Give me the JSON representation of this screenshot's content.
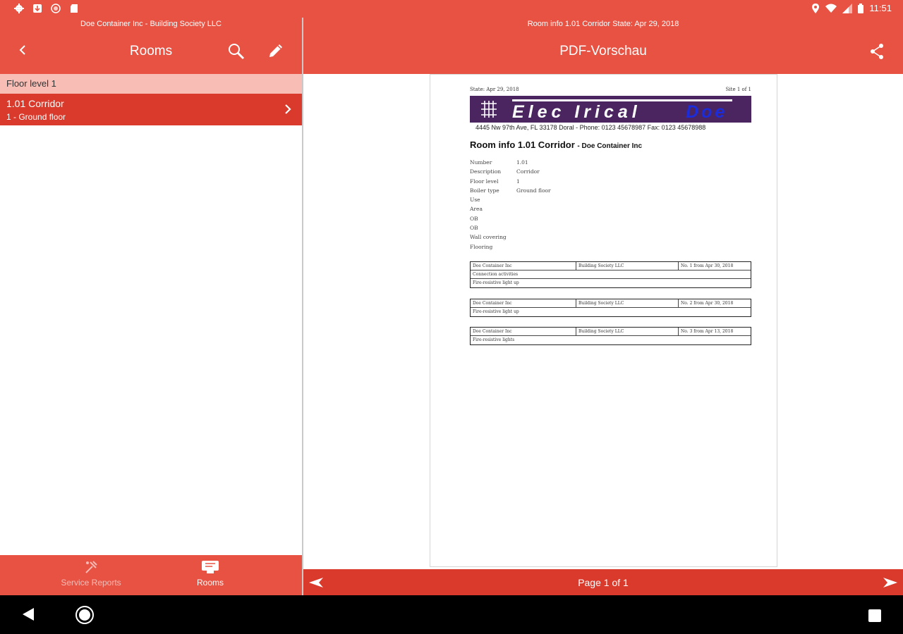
{
  "status_bar": {
    "time": "11:51",
    "left_icons": [
      "settings-icon",
      "download-icon",
      "sync-icon",
      "sd-card-icon"
    ],
    "right_icons": [
      "location-icon",
      "wifi-icon",
      "signal-icon",
      "battery-icon"
    ]
  },
  "left_pane": {
    "subtitle": "Doe Container Inc - Building Society LLC",
    "title": "Rooms",
    "section_header": "Floor level 1",
    "items": [
      {
        "title": "1.01 Corridor",
        "subtitle": "1 - Ground floor"
      }
    ],
    "bottom_nav": [
      {
        "label": "Service Reports",
        "icon": "service-reports-icon",
        "active": false
      },
      {
        "label": "Rooms",
        "icon": "rooms-icon",
        "active": true
      }
    ]
  },
  "right_pane": {
    "subtitle": "Room info 1.01 Corridor State: Apr 29, 2018",
    "title": "PDF-Vorschau",
    "pager": {
      "label": "Page 1 of 1"
    }
  },
  "pdf": {
    "state": "State: Apr 29, 2018",
    "site": "Site 1 of 1",
    "banner_word": "Elec Irical",
    "banner_brand": "Doe",
    "address": "4445 Nw 97th Ave, FL 33178 Doral - Phone: 0123 45678987 Fax: 0123 45678988",
    "heading": "Room info 1.01 Corridor",
    "heading_sub": "- Doe Container Inc",
    "fields": [
      {
        "label": "Number",
        "value": "1.01"
      },
      {
        "label": "Description",
        "value": "Corridor"
      },
      {
        "label": "Floor level",
        "value": "1"
      },
      {
        "label": "Boiler type",
        "value": "Ground floor"
      },
      {
        "label": "Use",
        "value": ""
      },
      {
        "label": "Area",
        "value": ""
      },
      {
        "label": "OB",
        "value": ""
      },
      {
        "label": "OB",
        "value": ""
      },
      {
        "label": "Wall covering",
        "value": ""
      },
      {
        "label": "Flooring",
        "value": ""
      }
    ],
    "tables": [
      {
        "c1": "Doe Container Inc",
        "c2": "Building Society LLC",
        "c3": "No. 1 from Apr 30, 2018",
        "notes": [
          "Connection activities",
          "Fire-resistive light up"
        ]
      },
      {
        "c1": "Doe Container Inc",
        "c2": "Building Society LLC",
        "c3": "No. 2 from Apr 30, 2018",
        "notes": [
          "Fire-resistive light up"
        ]
      },
      {
        "c1": "Doe Container Inc",
        "c2": "Building Society LLC",
        "c3": "No. 3 from Apr 13, 2018",
        "notes": [
          "Fire-resistive lights"
        ]
      }
    ]
  },
  "system_nav": {
    "icons": [
      "back-icon",
      "home-icon",
      "recents-icon"
    ]
  }
}
